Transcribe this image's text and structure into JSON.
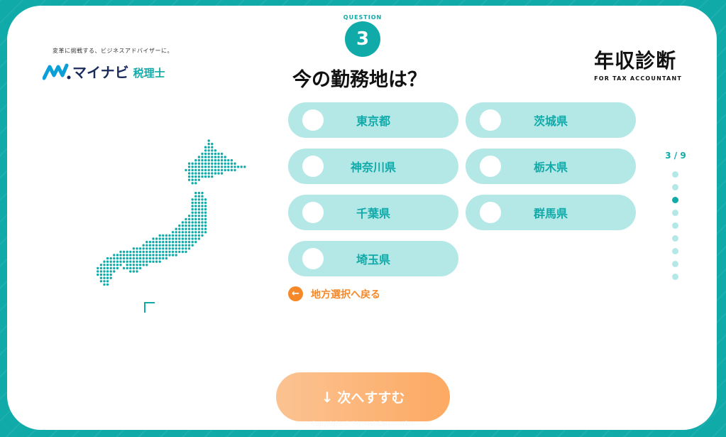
{
  "header": {
    "tagline": "変革に挑戦する、ビジネスアドバイザーに。",
    "logo_text": "マイナビ",
    "logo_sub": "税理士",
    "brand_title": "年収診断",
    "brand_sub": "FOR TAX ACCOUNTANT"
  },
  "question": {
    "label": "QUESTION",
    "number": "3",
    "title": "今の勤務地は？"
  },
  "options": [
    {
      "label": "東京都"
    },
    {
      "label": "茨城県"
    },
    {
      "label": "神奈川県"
    },
    {
      "label": "栃木県"
    },
    {
      "label": "千葉県"
    },
    {
      "label": "群馬県"
    },
    {
      "label": "埼玉県"
    }
  ],
  "back_link": {
    "label": "地方選択へ戻る",
    "icon": "arrow-left-icon"
  },
  "progress": {
    "text": "3 / 9",
    "current": 3,
    "total": 9
  },
  "next_button": {
    "label": "次へすすむ",
    "icon": "arrow-down-icon"
  },
  "footer": {
    "copyright": "Copyright © Mynavi Corporation"
  },
  "colors": {
    "teal": "#10aaa9",
    "light_teal": "#b4e8e7",
    "orange": "#f5892a",
    "button": "#fda962"
  }
}
